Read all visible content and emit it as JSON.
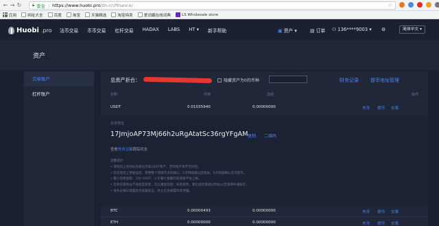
{
  "browser": {
    "secure_label": "安全",
    "url_host": "https://www.huobi.pro",
    "url_path": "/zh-cn/finance/",
    "bookmarks": [
      "应用",
      "网址大全",
      "百度",
      "淘宝",
      "天猫精选",
      "淘宝特卖",
      "爱词霸在线词典",
      "LS Wholesale store"
    ]
  },
  "header": {
    "logo_text": "Huobi",
    "logo_suffix": ".pro",
    "nav": [
      "法币交易",
      "币币交易",
      "杠杆交易",
      "HADAX",
      "LABS",
      "HT ▾",
      "新手帮助"
    ],
    "assets_label": "资产 ▾",
    "orders_label": "订单",
    "account_label": "136****9003 ▾",
    "lang_label": "简体中文 ▾"
  },
  "page": {
    "title": "资产"
  },
  "sidebar": {
    "items": [
      {
        "label": "交易账户",
        "active": true
      },
      {
        "label": "杠杆账户",
        "active": false
      }
    ]
  },
  "main": {
    "total_label": "总资产折合：",
    "hide_zero_label": "隐藏资产为0的币种",
    "finance_records": "财务记录",
    "address_mgmt": "提币地址管理",
    "columns": {
      "currency": "币种",
      "available": "可用",
      "frozen": "冻结",
      "ops": "操作"
    },
    "actions": {
      "deposit": "充币",
      "withdraw": "提币",
      "trade": "交易"
    },
    "rows": [
      {
        "currency": "USDT",
        "available": "0.01035940",
        "frozen": "0.00000000"
      },
      {
        "currency": "BTC",
        "available": "0.00000493",
        "frozen": "0.00000000"
      },
      {
        "currency": "ETH",
        "available": "0.00000000",
        "frozen": "0.00000000"
      }
    ],
    "deposit": {
      "label": "充币地址",
      "address": "17JmjoAP73Mj66h2uRgAtatSc36rgYFgAM",
      "copy": "复制",
      "qr": "二维码",
      "view_prefix": "查看",
      "view_link": "充币记录",
      "view_suffix": "跟踪状态",
      "notes_title": "温馨提示",
      "notes": [
        "• 请勿向上述地址充值任何非USDT资产，否则资产将不可找回。",
        "• 您充值至上述地址后，需要整个网络节点的确认，1次网络确认后到账，6次网络确认后可提币。",
        "• 最小充值金额：100 USDT，小于最小金额的充值将不会上账。",
        "• 您的充值地址不会经常改变，可以重复充值；如有更改，我们会尽量通过网站公告或邮件通知您。",
        "• 请务必确认电脑及浏览器安全，防止信息被篡改或泄露。"
      ]
    }
  }
}
